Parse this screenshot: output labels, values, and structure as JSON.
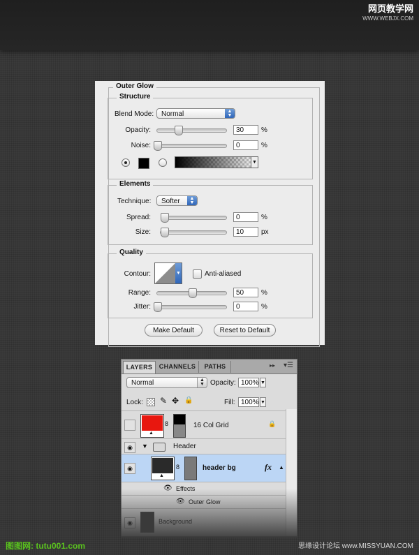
{
  "watermarks": {
    "top_right": "网页教学网",
    "top_right_sub": "WWW.WEBJX.COM",
    "bottom_left": "图图网: tutu001.com",
    "bottom_right": "思缘设计论坛 www.MISSYUAN.COM"
  },
  "outer_glow": {
    "title": "Outer Glow",
    "structure": {
      "legend": "Structure",
      "blend_mode_label": "Blend Mode:",
      "blend_mode_value": "Normal",
      "opacity_label": "Opacity:",
      "opacity_value": "30",
      "opacity_fraction": 0.3,
      "opacity_unit": "%",
      "noise_label": "Noise:",
      "noise_value": "0",
      "noise_fraction": 0,
      "noise_unit": "%"
    },
    "elements": {
      "legend": "Elements",
      "technique_label": "Technique:",
      "technique_value": "Softer",
      "spread_label": "Spread:",
      "spread_value": "0",
      "spread_fraction": 0,
      "spread_unit": "%",
      "size_label": "Size:",
      "size_value": "10",
      "size_fraction": 0.05,
      "size_unit": "px"
    },
    "quality": {
      "legend": "Quality",
      "contour_label": "Contour:",
      "anti_aliased_label": "Anti-aliased",
      "anti_aliased_checked": false,
      "range_label": "Range:",
      "range_value": "50",
      "range_fraction": 0.5,
      "range_unit": "%",
      "jitter_label": "Jitter:",
      "jitter_value": "0",
      "jitter_fraction": 0,
      "jitter_unit": "%"
    },
    "buttons": {
      "make_default": "Make Default",
      "reset_default": "Reset to Default"
    }
  },
  "layers_panel": {
    "tabs": [
      "LAYERS",
      "CHANNELS",
      "PATHS"
    ],
    "blend_mode": "Normal",
    "opacity_label": "Opacity:",
    "opacity_value": "100%",
    "lock_label": "Lock:",
    "fill_label": "Fill:",
    "fill_value": "100%",
    "layers": {
      "grid": "16 Col Grid",
      "header_group": "Header",
      "header_bg": "header bg",
      "effects": "Effects",
      "outer_glow": "Outer Glow",
      "background": "Background"
    },
    "colors": {
      "grid_swatch": "#e8170f",
      "selected_row": "#bcd6f5",
      "header_bg_swatch": "#2a2a2a"
    }
  }
}
